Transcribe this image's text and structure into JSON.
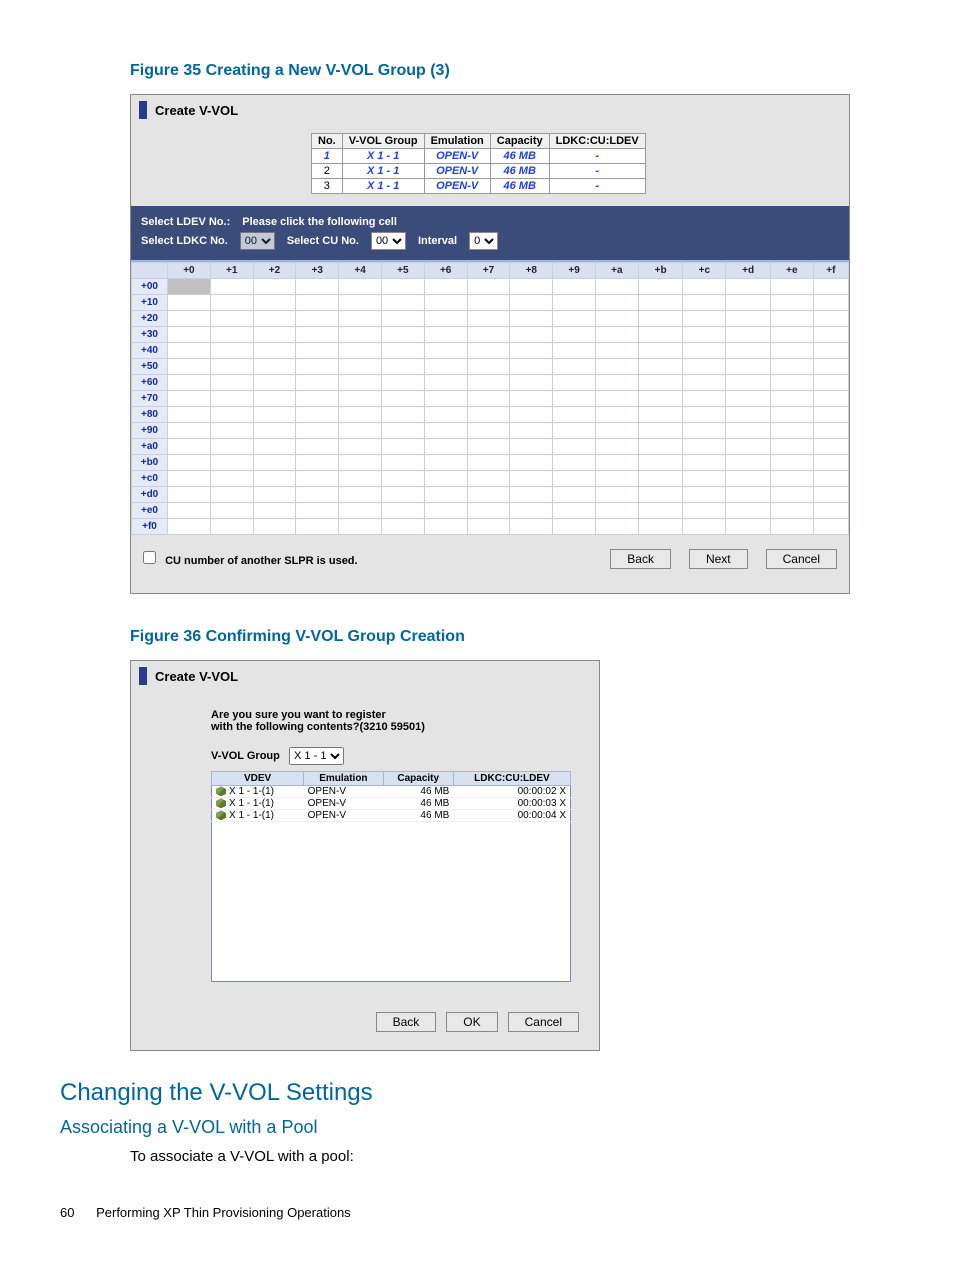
{
  "figure35": {
    "caption": "Figure 35 Creating a New V-VOL Group (3)",
    "window_title": "Create V-VOL",
    "top_table": {
      "headers": [
        "No.",
        "V-VOL Group",
        "Emulation",
        "Capacity",
        "LDKC:CU:LDEV"
      ],
      "rows": [
        {
          "no": "1",
          "group": "X 1 - 1",
          "em": "OPEN-V",
          "cap": "46 MB",
          "ldev": "-"
        },
        {
          "no": "2",
          "group": "X 1 - 1",
          "em": "OPEN-V",
          "cap": "46 MB",
          "ldev": "-"
        },
        {
          "no": "3",
          "group": "X 1 - 1",
          "em": "OPEN-V",
          "cap": "46 MB",
          "ldev": "-"
        }
      ]
    },
    "select_ldev_label": "Select LDEV No.:",
    "select_ldev_hint": "Please click the following cell",
    "select_ldkc_label": "Select LDKC No.",
    "select_ldkc_value": "00",
    "select_cu_label": "Select CU No.",
    "select_cu_value": "00",
    "interval_label": "Interval",
    "interval_value": "0",
    "grid_cols": [
      "+0",
      "+1",
      "+2",
      "+3",
      "+4",
      "+5",
      "+6",
      "+7",
      "+8",
      "+9",
      "+a",
      "+b",
      "+c",
      "+d",
      "+e",
      "+f"
    ],
    "grid_rows": [
      "+00",
      "+10",
      "+20",
      "+30",
      "+40",
      "+50",
      "+60",
      "+70",
      "+80",
      "+90",
      "+a0",
      "+b0",
      "+c0",
      "+d0",
      "+e0",
      "+f0"
    ],
    "slpr_checkbox_label": "CU number of another SLPR is used.",
    "btn_back": "Back",
    "btn_next": "Next",
    "btn_cancel": "Cancel"
  },
  "figure36": {
    "caption": "Figure 36 Confirming V-VOL Group Creation",
    "window_title": "Create V-VOL",
    "confirm_line1": "Are you sure you want to register",
    "confirm_line2": "with the following contents?(3210 59501)",
    "vvol_group_label": "V-VOL Group",
    "vvol_group_value": "X 1 - 1",
    "headers": [
      "VDEV",
      "Emulation",
      "Capacity",
      "LDKC:CU:LDEV"
    ],
    "rows": [
      {
        "vdev": "X 1 - 1-(1)",
        "em": "OPEN-V",
        "cap": "46 MB",
        "ldev": "00:00:02 X"
      },
      {
        "vdev": "X 1 - 1-(1)",
        "em": "OPEN-V",
        "cap": "46 MB",
        "ldev": "00:00:03 X"
      },
      {
        "vdev": "X 1 - 1-(1)",
        "em": "OPEN-V",
        "cap": "46 MB",
        "ldev": "00:00:04 X"
      }
    ],
    "btn_back": "Back",
    "btn_ok": "OK",
    "btn_cancel": "Cancel"
  },
  "sections": {
    "h1": "Changing the V-VOL Settings",
    "h2": "Associating a V-VOL with a Pool",
    "para": "To associate a V-VOL with a pool:"
  },
  "footer": {
    "page": "60",
    "chapter": "Performing XP Thin Provisioning Operations"
  }
}
